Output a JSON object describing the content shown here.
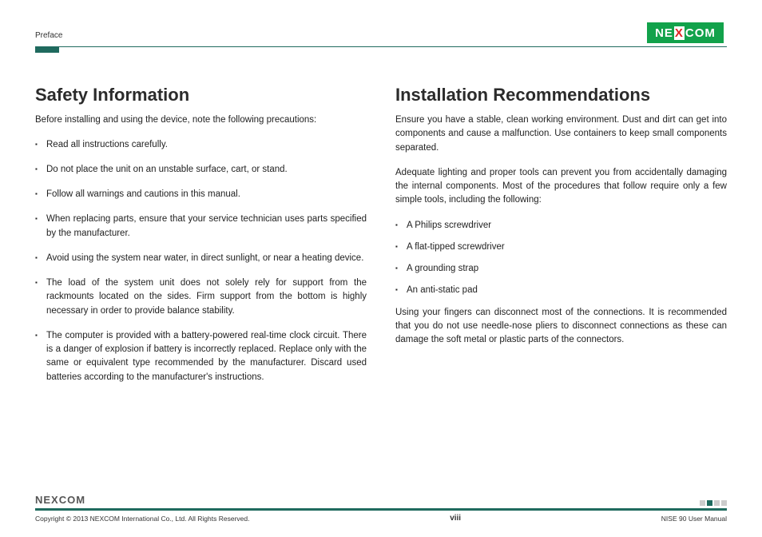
{
  "header": {
    "section_label": "Preface",
    "logo_text_left": "NE",
    "logo_text_x": "X",
    "logo_text_right": "COM"
  },
  "left": {
    "heading": "Safety Information",
    "intro": "Before installing and using the device, note the following precautions:",
    "bullets": [
      "Read all instructions carefully.",
      "Do not place the unit on an unstable surface, cart, or stand.",
      "Follow all warnings and cautions in this manual.",
      "When replacing parts, ensure that your service technician uses parts specified by the manufacturer.",
      "Avoid using the system near water, in direct sunlight, or near a heating device.",
      "The load of the system unit does not solely rely for support from the rackmounts located on the sides. Firm support from the bottom is highly necessary in order to provide balance stability.",
      "The computer is provided with a battery-powered real-time clock circuit. There is a danger of explosion if battery is incorrectly replaced. Replace only with the same or equivalent type recommended by the manufacturer. Discard used batteries according to the manufacturer's instructions."
    ]
  },
  "right": {
    "heading": "Installation Recommendations",
    "para1": "Ensure you have a stable, clean working environment. Dust and dirt can get into components and cause a malfunction. Use containers to keep small components separated.",
    "para2": "Adequate lighting and proper tools can prevent you from accidentally damaging the internal components. Most of the procedures that follow require only a few simple tools, including the following:",
    "bullets": [
      "A Philips screwdriver",
      "A flat-tipped screwdriver",
      "A grounding strap",
      "An anti-static pad"
    ],
    "para3": "Using your fingers can disconnect most of the connections. It is recommended that you do not use needle-nose pliers to disconnect connections as these can damage the soft metal or plastic parts of the connectors."
  },
  "footer": {
    "logo_text": "NEXCOM",
    "copyright": "Copyright © 2013 NEXCOM International Co., Ltd. All Rights Reserved.",
    "page_number": "viii",
    "manual_ref": "NISE 90 User Manual"
  }
}
